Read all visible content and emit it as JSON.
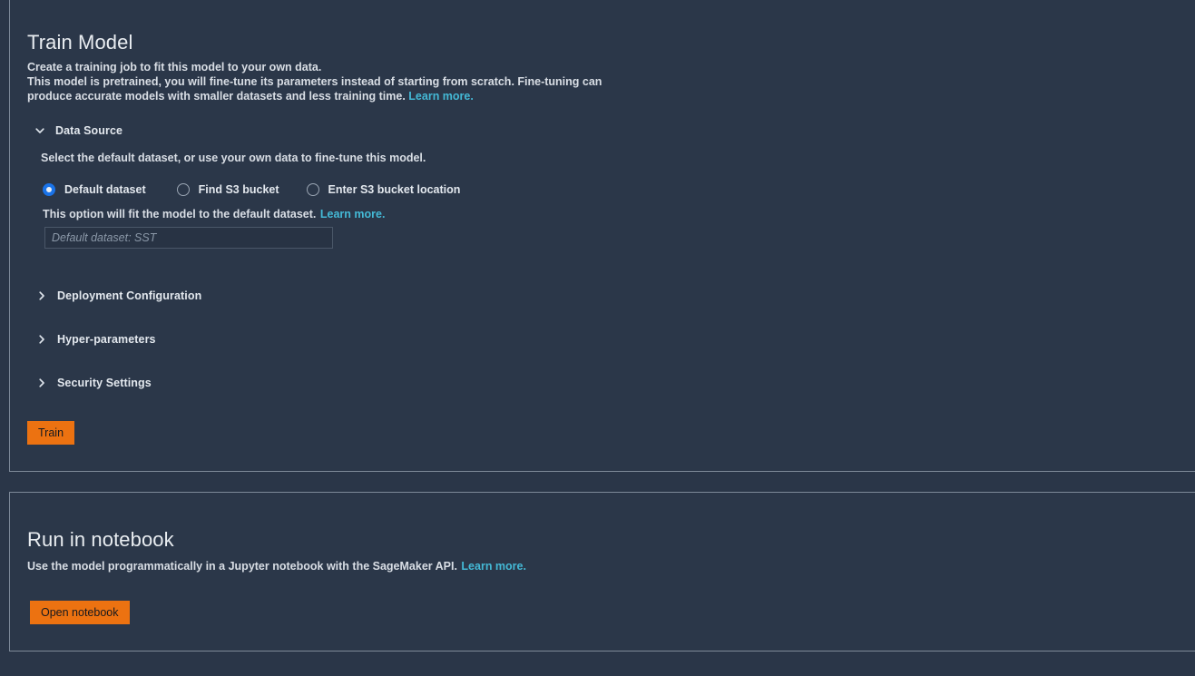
{
  "colors": {
    "page_background": "#2a3648",
    "panel_background": "#2b3749",
    "panel_border": "#7d8998",
    "link": "#44b9d6",
    "button_primary": "#ec7211",
    "button_primary_text": "#16191f",
    "radio_selected": "#1a73e8",
    "text_primary": "#e7eaee",
    "placeholder": "#8b98a8"
  },
  "train_panel": {
    "title": "Train Model",
    "description": {
      "line1": "Create a training job to fit this model to your own data.",
      "line2": "This model is pretrained, you will fine-tune its parameters instead of starting from scratch. Fine-tuning can",
      "line3": "produce accurate models with smaller datasets and less training time.",
      "learn_more": "Learn more."
    },
    "sections": [
      {
        "id": "data-source",
        "label": "Data Source",
        "expanded": true,
        "icon": "chevron-down-icon",
        "subtitle": "Select the default dataset, or use your own data to fine-tune this model.",
        "radios": [
          {
            "id": "default-dataset",
            "label": "Default dataset",
            "selected": true
          },
          {
            "id": "find-s3-bucket",
            "label": "Find S3 bucket",
            "selected": false
          },
          {
            "id": "enter-s3-bucket-location",
            "label": "Enter S3 bucket location",
            "selected": false
          }
        ],
        "help_text": "This option will fit the model to the default dataset.",
        "help_learn_more": "Learn more.",
        "input": {
          "value": "",
          "placeholder": "Default dataset: SST"
        }
      },
      {
        "id": "deployment-configuration",
        "label": "Deployment Configuration",
        "expanded": false,
        "icon": "chevron-right-icon"
      },
      {
        "id": "hyper-parameters",
        "label": "Hyper-parameters",
        "expanded": false,
        "icon": "chevron-right-icon"
      },
      {
        "id": "security-settings",
        "label": "Security Settings",
        "expanded": false,
        "icon": "chevron-right-icon"
      }
    ],
    "train_button": "Train"
  },
  "notebook_panel": {
    "title": "Run in notebook",
    "description": "Use the model programmatically in a Jupyter notebook with the SageMaker API.",
    "learn_more": "Learn more.",
    "open_button": "Open notebook"
  }
}
